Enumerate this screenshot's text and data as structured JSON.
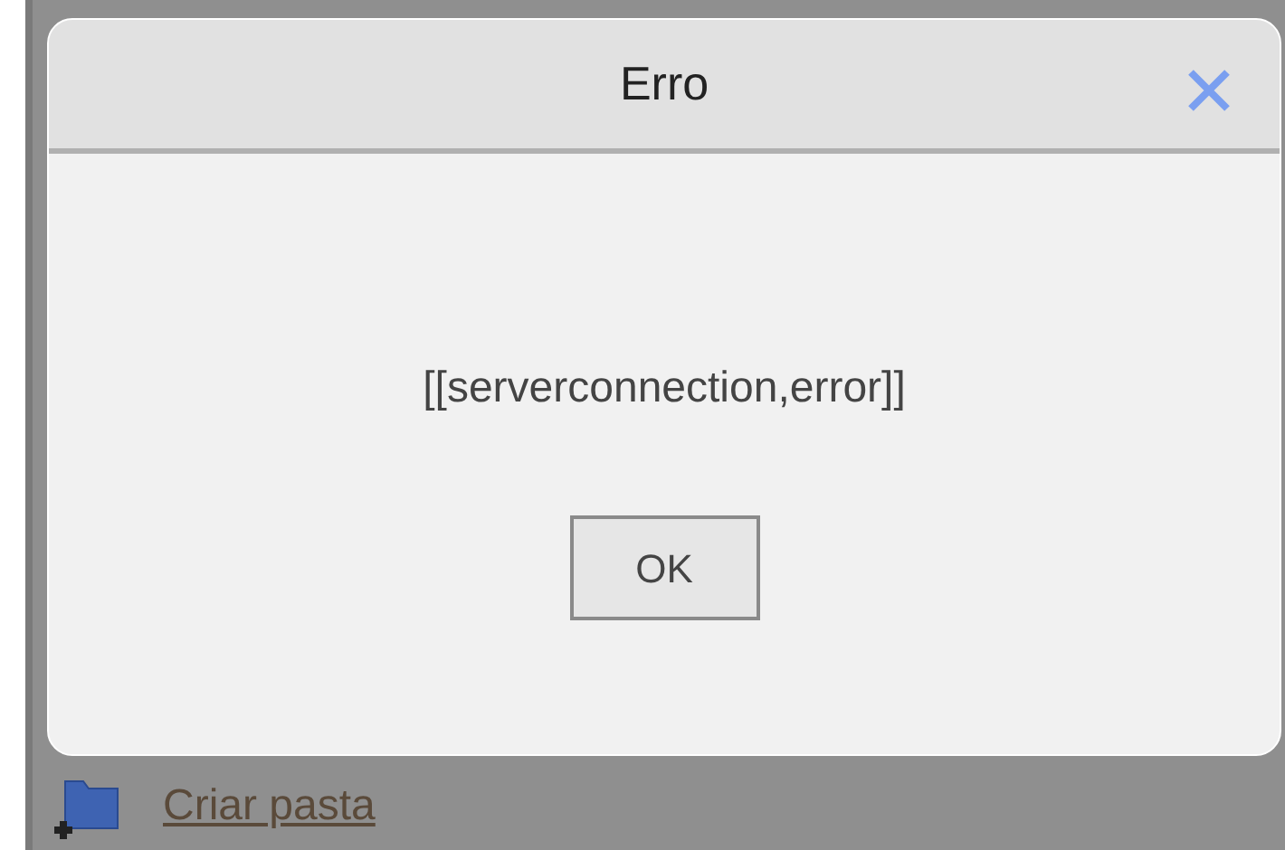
{
  "dialog": {
    "title": "Erro",
    "message": "[[serverconnection,error]]",
    "buttons": [
      "OK"
    ]
  },
  "footer": {
    "link": "Criar pasta"
  }
}
